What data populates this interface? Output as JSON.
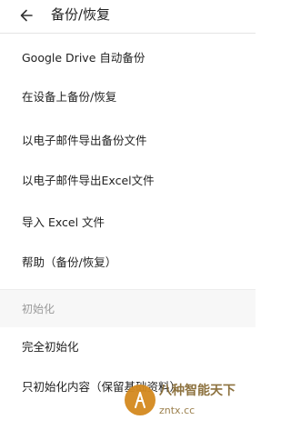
{
  "header": {
    "back_icon": "arrow-left-icon",
    "title": "备份/恢复"
  },
  "menu": {
    "items": [
      {
        "label": "Google Drive 自动备份"
      },
      {
        "label": "在设备上备份/恢复"
      },
      {
        "label": "以电子邮件导出备份文件"
      },
      {
        "label": "以电子邮件导出Excel文件"
      },
      {
        "label": "导入 Excel 文件"
      },
      {
        "label": "帮助（备份/恢复）"
      }
    ]
  },
  "init_section": {
    "header": "初始化",
    "items": [
      {
        "label": "完全初始化"
      },
      {
        "label": "只初始化内容（保留基础资料）"
      }
    ]
  },
  "watermark": {
    "text": "八种智能天下",
    "url": "zntx.cc"
  },
  "colors": {
    "divider": "#e4e4e4",
    "section_bg": "#f7f7f7",
    "section_label": "#9a9a9a",
    "watermark": "#d48a1f"
  }
}
